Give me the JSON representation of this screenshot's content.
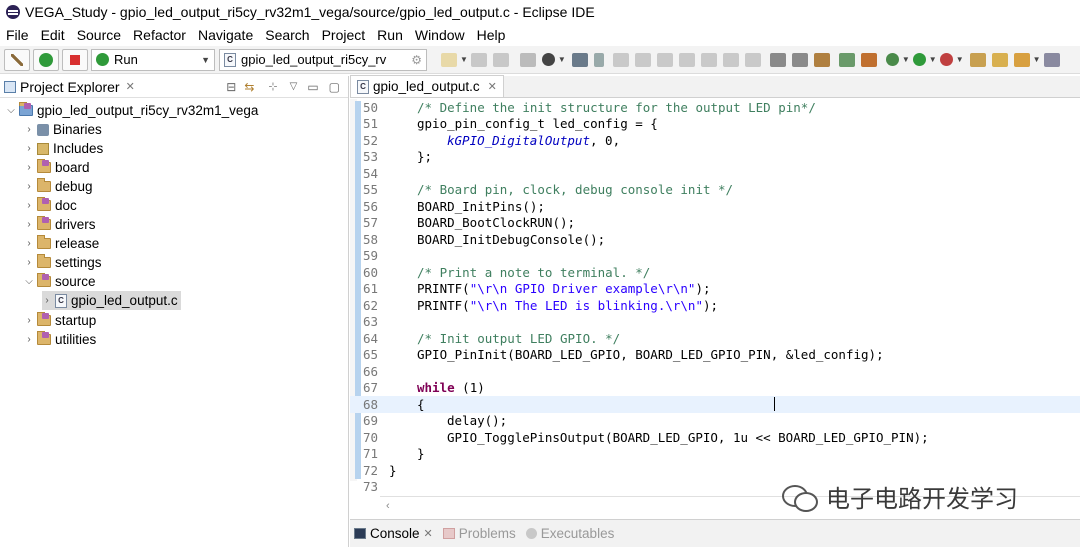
{
  "window": {
    "title": "VEGA_Study - gpio_led_output_ri5cy_rv32m1_vega/source/gpio_led_output.c - Eclipse IDE"
  },
  "menu": [
    "File",
    "Edit",
    "Source",
    "Refactor",
    "Navigate",
    "Search",
    "Project",
    "Run",
    "Window",
    "Help"
  ],
  "toolbar": {
    "run_config": "Run",
    "launch_target": "gpio_led_output_ri5cy_rv"
  },
  "explorer": {
    "tab_label": "Project Explorer",
    "project": "gpio_led_output_ri5cy_rv32m1_vega",
    "items": [
      "Binaries",
      "Includes",
      "board",
      "debug",
      "doc",
      "drivers",
      "release",
      "settings",
      "source",
      "startup",
      "utilities"
    ],
    "source_child": "gpio_led_output.c"
  },
  "editor": {
    "tab_label": "gpio_led_output.c",
    "line_numbers": [
      "50",
      "51",
      "52",
      "53",
      "54",
      "55",
      "56",
      "57",
      "58",
      "59",
      "60",
      "61",
      "62",
      "63",
      "64",
      "65",
      "66",
      "67",
      "68",
      "69",
      "70",
      "71",
      "72",
      "73"
    ],
    "code": {
      "l50": "/* Define the init structure for the output LED pin*/",
      "l51": "gpio_pin_config_t led_config = {",
      "l52": "kGPIO_DigitalOutput",
      "l52b": ", 0,",
      "l53": "};",
      "l55": "/* Board pin, clock, debug console init */",
      "l56": "BOARD_InitPins();",
      "l57": "BOARD_BootClockRUN();",
      "l58": "BOARD_InitDebugConsole();",
      "l60": "/* Print a note to terminal. */",
      "l61a": "PRINTF(",
      "l61b": "\"\\r\\n GPIO Driver example\\r\\n\"",
      "l61c": ");",
      "l62a": "PRINTF(",
      "l62b": "\"\\r\\n The LED is blinking.\\r\\n\"",
      "l62c": ");",
      "l64": "/* Init output LED GPIO. */",
      "l65": "GPIO_PinInit(BOARD_LED_GPIO, BOARD_LED_GPIO_PIN, &led_config);",
      "l67a": "while",
      "l67b": " (1)",
      "l68": "{",
      "l69": "delay();",
      "l70": "GPIO_TogglePinsOutput(BOARD_LED_GPIO, 1u << BOARD_LED_GPIO_PIN);",
      "l71": "}",
      "l72": "}",
      "l73": ""
    }
  },
  "bottom_tabs": {
    "console": "Console",
    "problems": "Problems",
    "executables": "Executables"
  },
  "watermark": "电子电路开发学习",
  "colors": {
    "comment": "#3f7f5f",
    "keyword": "#7f0055",
    "string": "#2a00ff",
    "enum": "#0000c0",
    "gutter": "#b7d3ee"
  }
}
